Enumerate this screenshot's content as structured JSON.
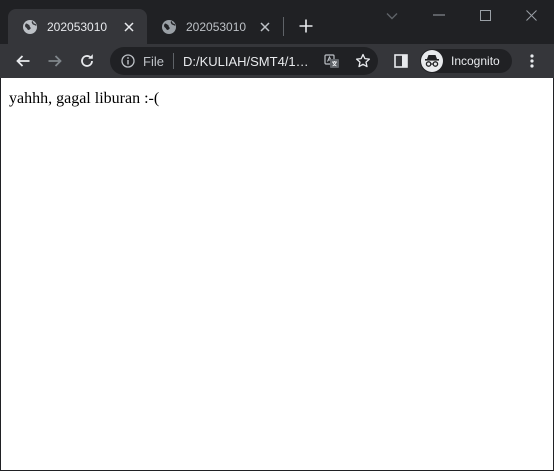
{
  "tabs": [
    {
      "title": "202053010",
      "active": true
    },
    {
      "title": "202053010",
      "active": false
    }
  ],
  "toolbar": {
    "file_label": "File",
    "url": "D:/KULIAH/SMT4/1…"
  },
  "profile": {
    "label": "Incognito"
  },
  "page": {
    "text": "yahhh, gagal liburan :-("
  },
  "icons": {
    "favicon": "globe-icon",
    "tab_close": "close-icon",
    "new_tab": "plus-icon",
    "tab_search": "chevron-down-icon",
    "back": "arrow-left-icon",
    "forward": "arrow-right-icon",
    "reload": "reload-icon",
    "site_info": "info-icon",
    "translate": "translate-icon",
    "bookmark": "star-icon",
    "side_panel": "side-panel-icon",
    "incognito": "incognito-icon",
    "menu": "kebab-menu-icon"
  },
  "colors": {
    "frame": "#202124",
    "toolbar": "#35363a",
    "page_background": "#ffffff"
  }
}
